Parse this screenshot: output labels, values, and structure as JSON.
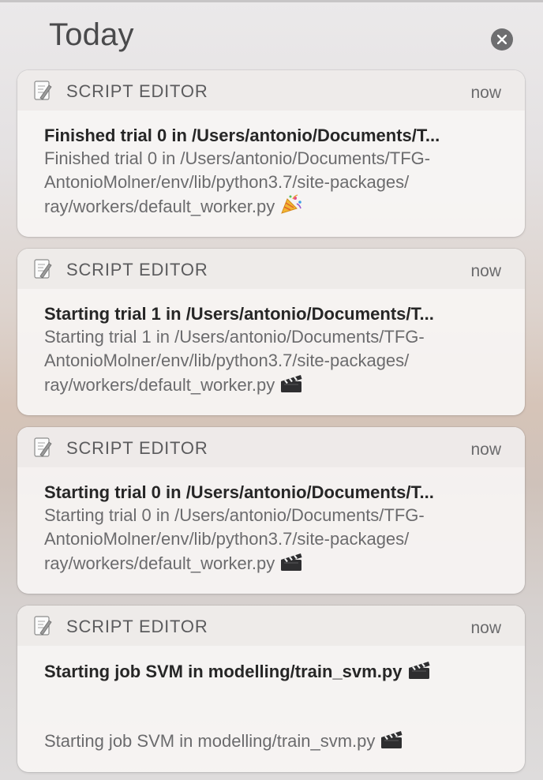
{
  "header": {
    "title": "Today",
    "close_icon": "close-circle-icon"
  },
  "notifications": [
    {
      "app_name": "SCRIPT EDITOR",
      "app_icon": "script-editor-icon",
      "time": "now",
      "title": "Finished trial 0 in /Users/antonio/Documents/T...",
      "message_lines": [
        "Finished trial 0 in /Users/antonio/Documents/TFG-",
        "AntonioMolner/env/lib/python3.7/site-packages/",
        "ray/workers/default_worker.py"
      ],
      "emoji": "party-popper-icon"
    },
    {
      "app_name": "SCRIPT EDITOR",
      "app_icon": "script-editor-icon",
      "time": "now",
      "title": "Starting trial 1 in /Users/antonio/Documents/T...",
      "message_lines": [
        "Starting trial 1 in /Users/antonio/Documents/TFG-",
        "AntonioMolner/env/lib/python3.7/site-packages/",
        "ray/workers/default_worker.py"
      ],
      "emoji": "clapper-board-icon"
    },
    {
      "app_name": "SCRIPT EDITOR",
      "app_icon": "script-editor-icon",
      "time": "now",
      "title": "Starting trial 0 in /Users/antonio/Documents/T...",
      "message_lines": [
        "Starting trial 0 in /Users/antonio/Documents/TFG-",
        "AntonioMolner/env/lib/python3.7/site-packages/",
        "ray/workers/default_worker.py"
      ],
      "emoji": "clapper-board-icon"
    },
    {
      "app_name": "SCRIPT EDITOR",
      "app_icon": "script-editor-icon",
      "time": "now",
      "title": "Starting job SVM in modelling/train_svm.py",
      "title_emoji": "clapper-board-icon",
      "message_lines": [
        "Starting job SVM in modelling/train_svm.py"
      ],
      "emoji": "clapper-board-icon"
    }
  ]
}
